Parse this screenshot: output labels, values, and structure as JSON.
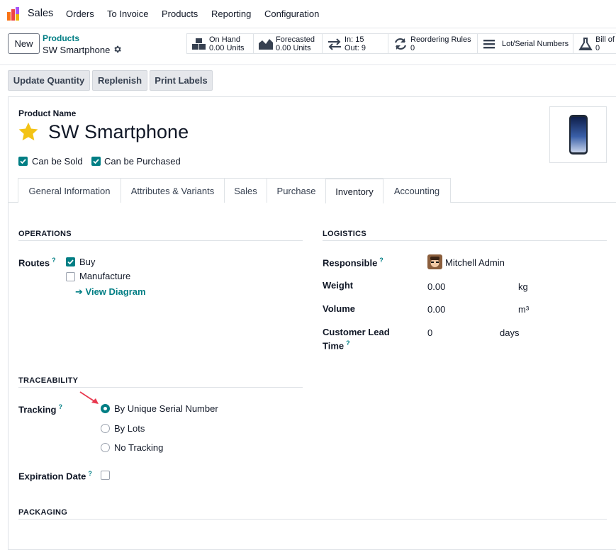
{
  "navbar": {
    "app_name": "Sales",
    "menu": [
      "Orders",
      "To Invoice",
      "Products",
      "Reporting",
      "Configuration"
    ]
  },
  "control_panel": {
    "new_label": "New",
    "breadcrumb_parent": "Products",
    "breadcrumb_current": "SW Smartphone",
    "stats": {
      "on_hand": {
        "label": "On Hand",
        "value": "0.00 Units"
      },
      "forecasted": {
        "label": "Forecasted",
        "value": "0.00 Units"
      },
      "in_out": {
        "in": "In: 15",
        "out": "Out: 9"
      },
      "reordering": {
        "label": "Reordering Rules",
        "value": "0"
      },
      "lots": {
        "label": "Lot/Serial Numbers"
      },
      "bom": {
        "label": "Bill of",
        "value": "0"
      }
    }
  },
  "actions": {
    "update_quantity": "Update Quantity",
    "replenish": "Replenish",
    "print_labels": "Print Labels"
  },
  "form": {
    "product_name_label": "Product Name",
    "product_name": "SW Smartphone",
    "can_be_sold": "Can be Sold",
    "can_be_purchased": "Can be Purchased",
    "tabs": [
      "General Information",
      "Attributes & Variants",
      "Sales",
      "Purchase",
      "Inventory",
      "Accounting"
    ],
    "active_tab": "Inventory",
    "operations": {
      "title": "OPERATIONS",
      "routes_label": "Routes",
      "route_buy": "Buy",
      "route_manufacture": "Manufacture",
      "view_diagram": "View Diagram"
    },
    "logistics": {
      "title": "LOGISTICS",
      "responsible_label": "Responsible",
      "responsible_value": "Mitchell Admin",
      "weight_label": "Weight",
      "weight_value": "0.00",
      "weight_unit": "kg",
      "volume_label": "Volume",
      "volume_value": "0.00",
      "volume_unit": "m³",
      "lead_label_1": "Customer Lead",
      "lead_label_2": "Time",
      "lead_value": "0",
      "lead_unit": "days"
    },
    "traceability": {
      "title": "TRACEABILITY",
      "tracking_label": "Tracking",
      "options": [
        "By Unique Serial Number",
        "By Lots",
        "No Tracking"
      ],
      "selected": "By Unique Serial Number",
      "expiration_label": "Expiration Date"
    },
    "packaging": {
      "title": "PACKAGING"
    }
  },
  "colors": {
    "accent": "#017e84",
    "annotation_arrow": "#e8384f",
    "star": "#f3c316"
  }
}
